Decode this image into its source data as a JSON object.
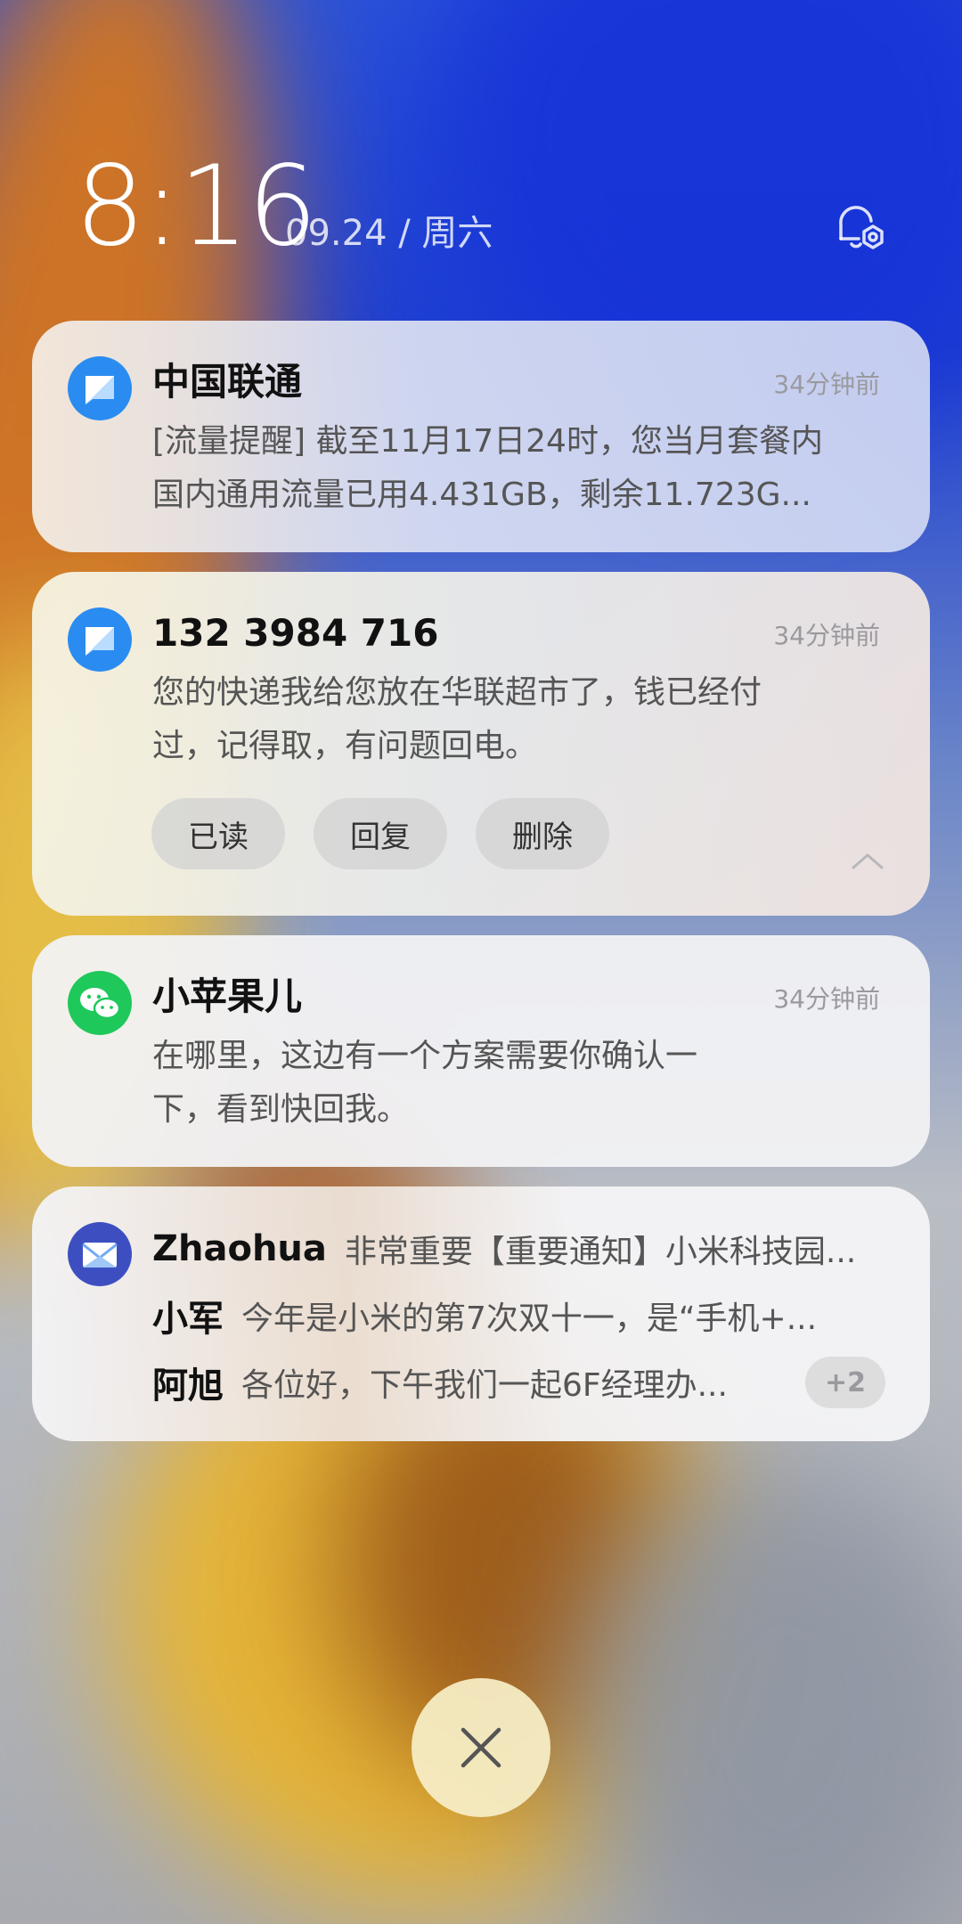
{
  "header": {
    "time": "8:16",
    "date": "09.24 / 周六"
  },
  "notifications": [
    {
      "app_icon": "message-icon",
      "title": "中国联通",
      "time": "34分钟前",
      "lines": [
        "[流量提醒] 截至11月17日24时，您当月套餐内",
        "国内通用流量已用4.431GB，剩余11.723G..."
      ]
    },
    {
      "app_icon": "message-icon",
      "title": "132 3984 716",
      "time": "34分钟前",
      "lines": [
        "您的快递我给您放在华联超市了，钱已经付",
        "过，记得取，有问题回电。"
      ],
      "actions": [
        "已读",
        "回复",
        "删除"
      ]
    },
    {
      "app_icon": "wechat-icon",
      "title": "小苹果儿",
      "time": "34分钟前",
      "lines": [
        "在哪里，这边有一个方案需要你确认一",
        "下，看到快回我。"
      ]
    },
    {
      "app_icon": "mail-icon",
      "rows": [
        {
          "sender": "Zhaohua",
          "snippet": "非常重要【重要通知】小米科技园..."
        },
        {
          "sender": "小军",
          "snippet": "今年是小米的第7次双十一，是“手机+..."
        },
        {
          "sender": "阿旭",
          "snippet": "各位好，下午我们一起6F经理办...",
          "badge": "+2"
        }
      ]
    }
  ],
  "colors": {
    "message_blue": "#2a8cf0",
    "wechat_green": "#1fc85b",
    "mail_indigo": "#3d4fc0"
  }
}
